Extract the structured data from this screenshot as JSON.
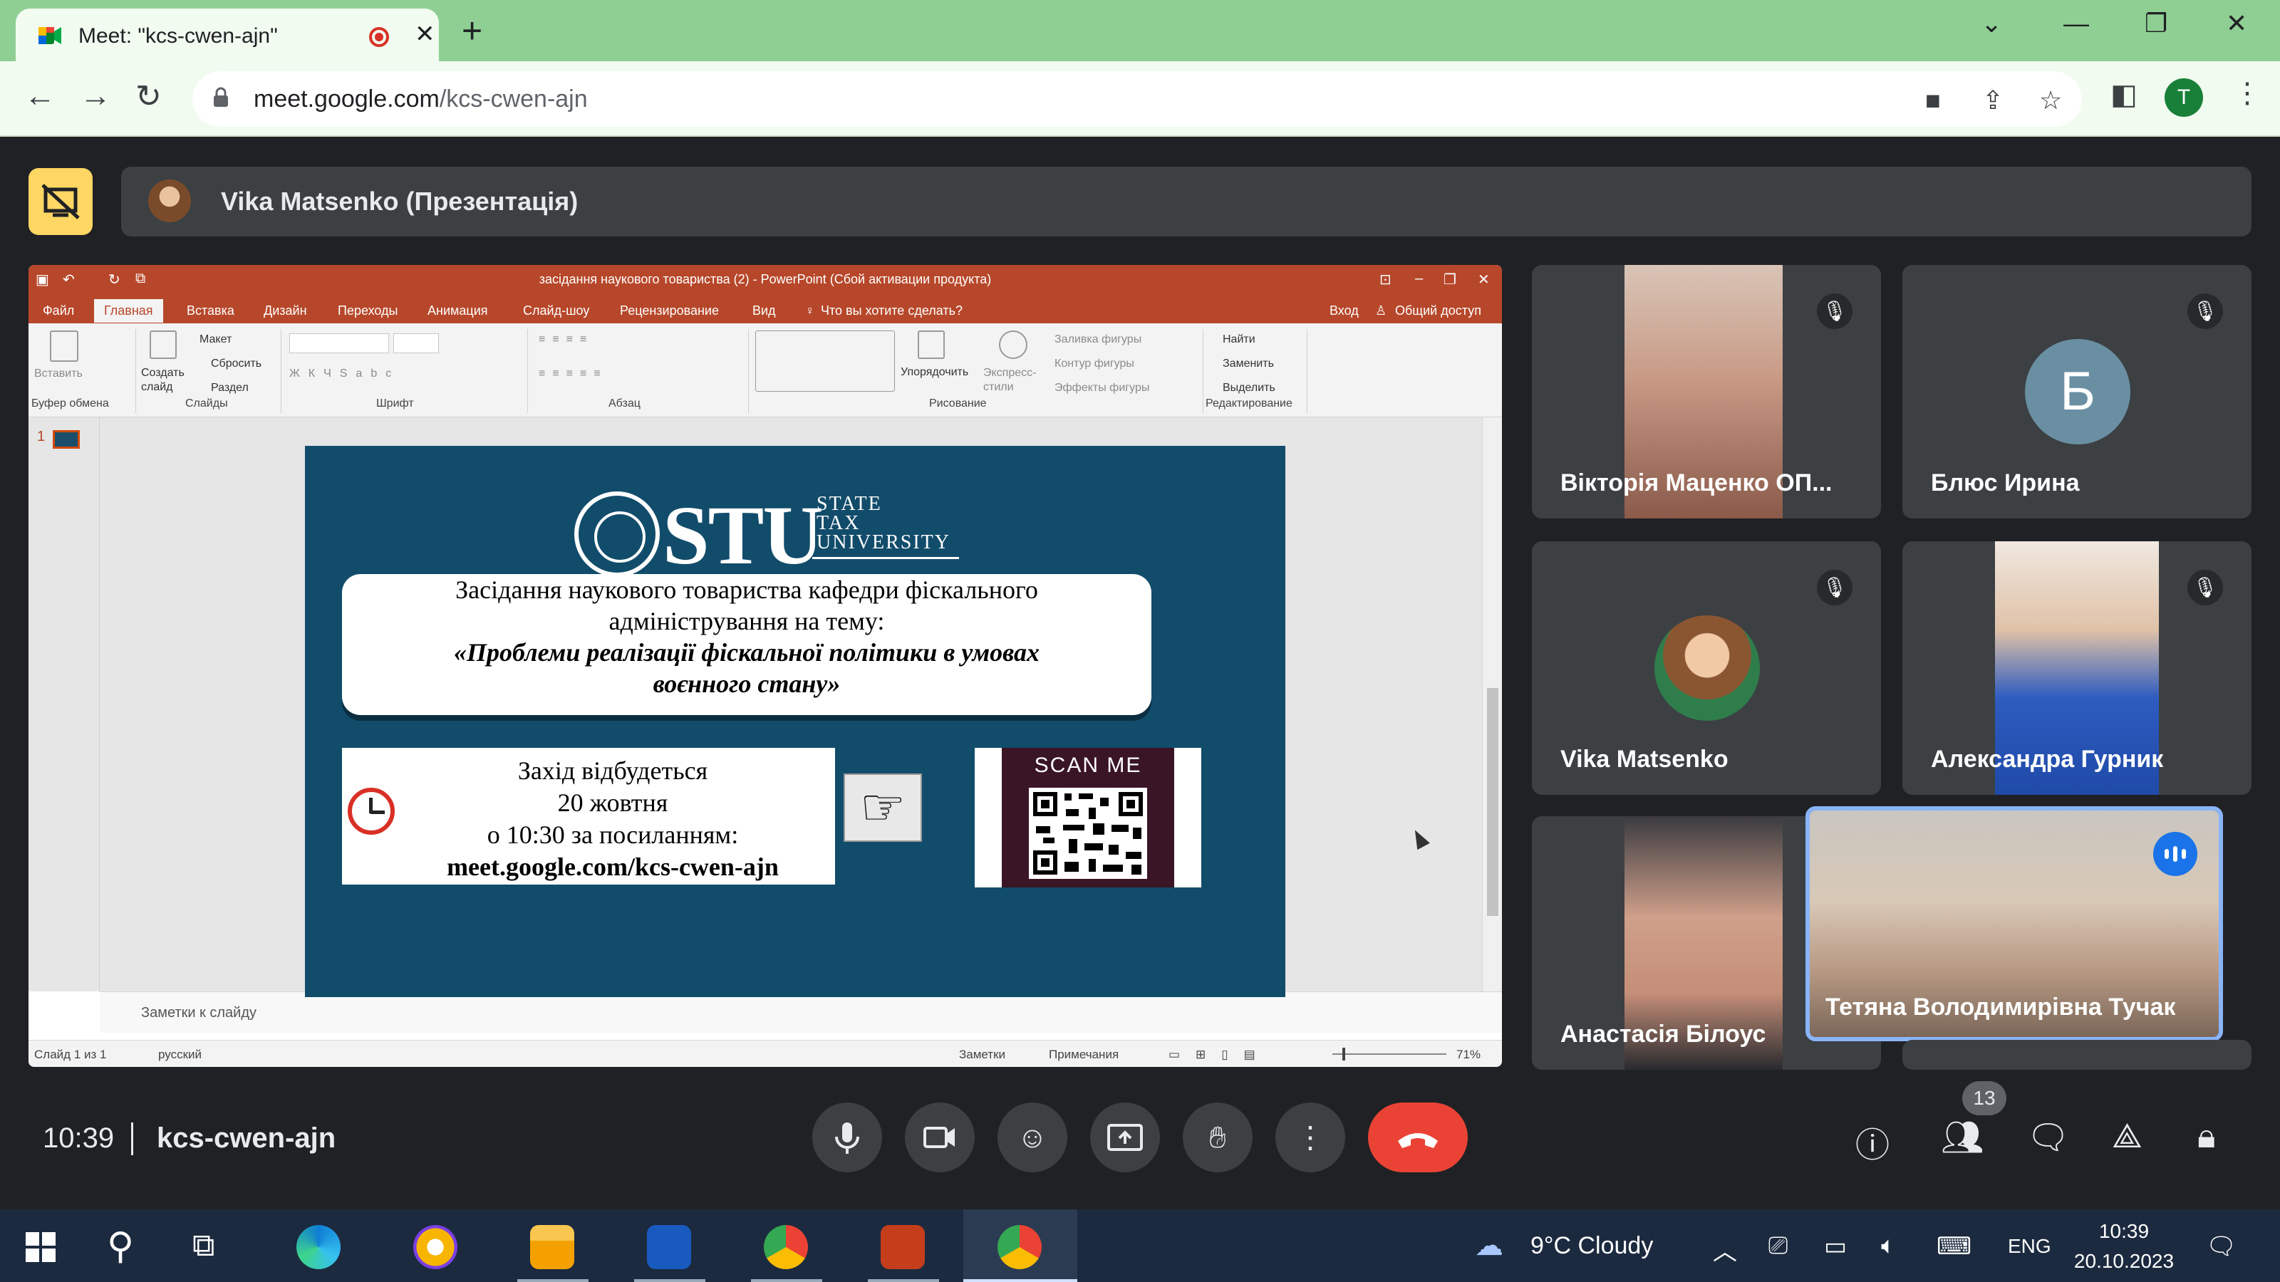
{
  "browser": {
    "tab_title": "Meet: \"kcs-cwen-ajn\"",
    "url_host": "meet.google.com",
    "url_path": "/kcs-cwen-ajn",
    "profile_initial": "T"
  },
  "meet": {
    "presenter_label": "Vika Matsenko (Презентація)",
    "time": "10:39",
    "meeting_code": "kcs-cwen-ajn",
    "participant_count": "13",
    "participants": [
      {
        "name": "Вікторія Маценко ОП...",
        "muted": true,
        "video": true
      },
      {
        "name": "Блюс Ирина",
        "muted": true,
        "initial": "Б"
      },
      {
        "name": "Vika Matsenko",
        "muted": true,
        "avatar": true
      },
      {
        "name": "Александра Гурник",
        "muted": true,
        "video": true
      },
      {
        "name": "Анастасія Білоус",
        "muted": false,
        "video": true
      },
      {
        "name": "Тетяна Володимирівна Тучак",
        "speaking": true,
        "video": true
      }
    ]
  },
  "powerpoint": {
    "window_title": "засідання наукового товариства (2) - PowerPoint (Сбой активации продукта)",
    "menu": [
      "Файл",
      "Главная",
      "Вставка",
      "Дизайн",
      "Переходы",
      "Анимация",
      "Слайд-шоу",
      "Рецензирование",
      "Вид",
      "Что вы хотите сделать?"
    ],
    "signin": "Вход",
    "share": "Общий доступ",
    "ribbon": {
      "paste": "Вставить",
      "create_slide": "Создать слайд",
      "layout": "Макет",
      "reset": "Сбросить",
      "section": "Раздел",
      "arrange": "Упорядочить",
      "quick_styles": "Экспресс-стили",
      "shape_fill": "Заливка фигуры",
      "shape_outline": "Контур фигуры",
      "shape_effects": "Эффекты фигуры",
      "find": "Найти",
      "replace": "Заменить",
      "select": "Выделить",
      "groups": [
        "Буфер обмена",
        "Слайды",
        "Шрифт",
        "Абзац",
        "Рисование",
        "Редактирование"
      ]
    },
    "notes_placeholder": "Заметки к слайду",
    "status": {
      "slide_info": "Слайд 1 из 1",
      "language": "русский",
      "notes": "Заметки",
      "comments": "Примечания",
      "zoom": "71%"
    },
    "slide_number": "1",
    "slide": {
      "logo_text": "STU",
      "logo_sub": [
        "STATE",
        "TAX",
        "UNIVERSITY"
      ],
      "title_line1": "Засідання наукового товариства кафедри фіскального",
      "title_line2": "адміністрування на тему:",
      "title_line3": "«Проблеми реалізації фіскальної політики в умовах",
      "title_line4": "воєнного стану»",
      "event_line1": "Захід відбудеться",
      "event_line2": "20 жовтня",
      "event_line3": "о 10:30 за посиланням:",
      "event_link": "meet.google.com/kcs-cwen-ajn",
      "scan_me": "SCAN ME"
    }
  },
  "taskbar": {
    "weather": "9°C  Cloudy",
    "lang": "ENG",
    "time": "10:39",
    "date": "20.10.2023"
  },
  "colors": {
    "tab_strip": "#8fcf94",
    "powerpoint_accent": "#b7472a",
    "slide_bg": "#124c6b",
    "end_call": "#ea4335",
    "meet_bg": "#202124"
  }
}
